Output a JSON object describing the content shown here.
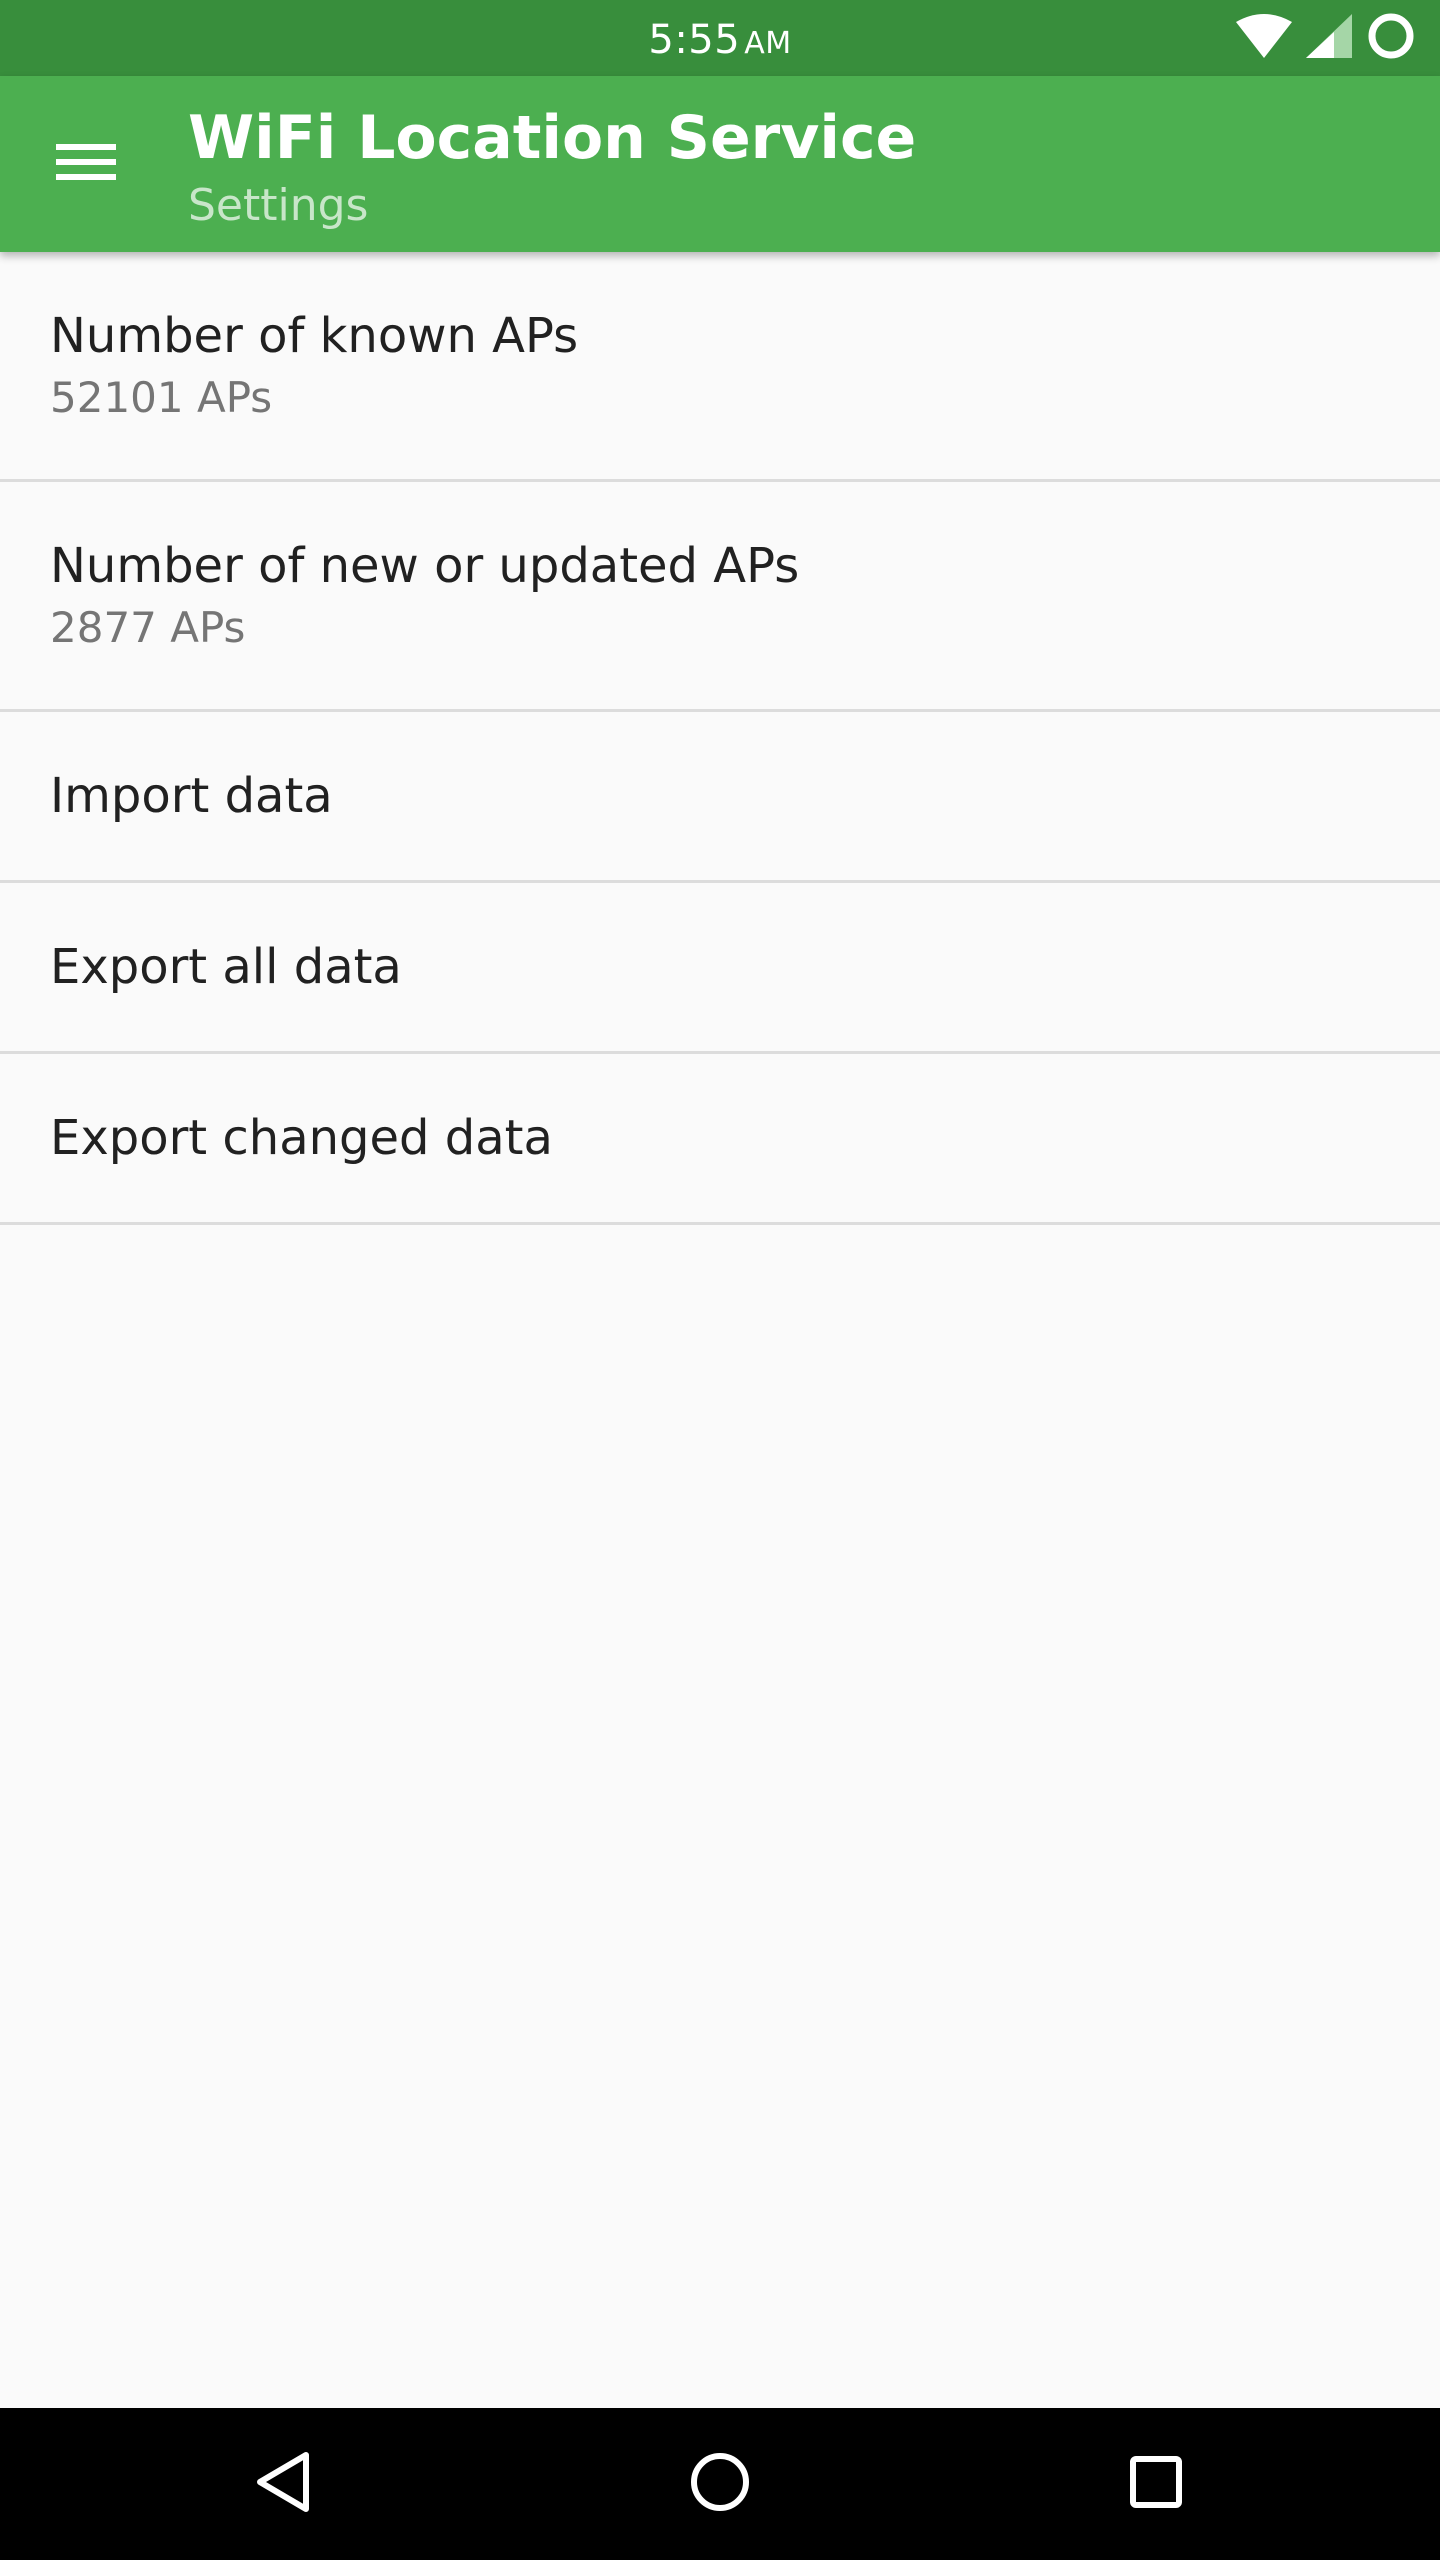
{
  "status_bar": {
    "time": "5:55",
    "ampm": "AM",
    "icons": [
      "wifi-icon",
      "cellular-signal-icon",
      "sync-circle-icon"
    ]
  },
  "app_bar": {
    "menu_icon": "hamburger-menu-icon",
    "title": "WiFi Location Service",
    "subtitle": "Settings"
  },
  "preferences": [
    {
      "title": "Number of known APs",
      "summary": "52101 APs"
    },
    {
      "title": "Number of new or updated APs",
      "summary": "2877 APs"
    },
    {
      "title": "Import data"
    },
    {
      "title": "Export all data"
    },
    {
      "title": "Export changed data"
    }
  ],
  "nav_bar": {
    "icons": [
      "back-icon",
      "home-icon",
      "recents-icon"
    ]
  },
  "colors": {
    "status_bar": "#388e3c",
    "app_bar": "#4caf50",
    "subtitle": "#c8e6c9",
    "background": "#fafafa"
  }
}
